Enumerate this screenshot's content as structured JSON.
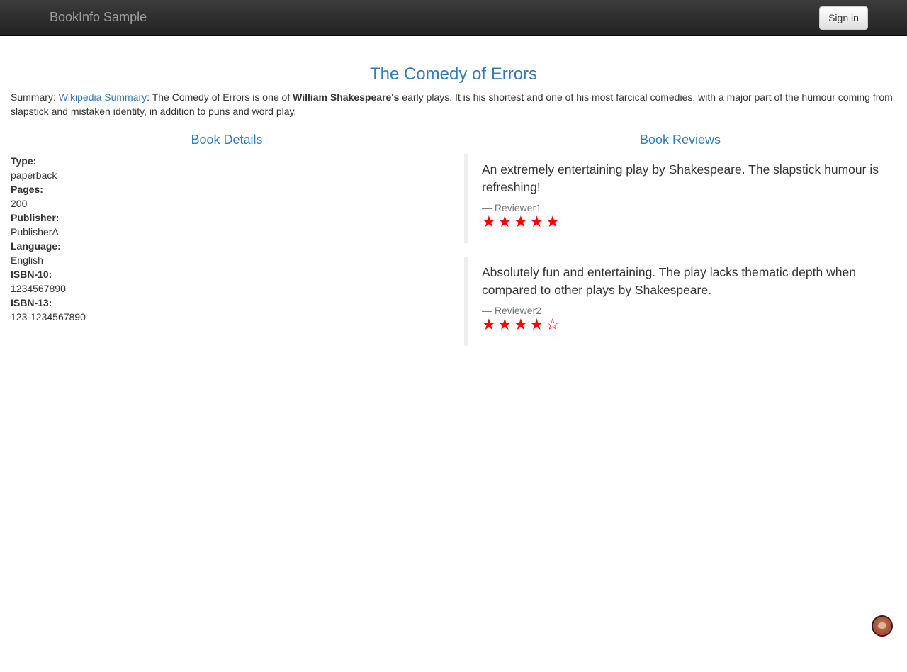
{
  "navbar": {
    "brand": "BookInfo Sample",
    "signin_label": "Sign in"
  },
  "book": {
    "title": "The Comedy of Errors",
    "summary_prefix": "Summary: ",
    "summary_link": "Wikipedia Summary",
    "summary_text_1": ": The Comedy of Errors is one of ",
    "summary_bold": "William Shakespeare's",
    "summary_text_2": " early plays. It is his shortest and one of his most farcical comedies, with a major part of the humour coming from slapstick and mistaken identity, in addition to puns and word play."
  },
  "details": {
    "heading": "Book Details",
    "items": [
      {
        "label": "Type:",
        "value": "paperback"
      },
      {
        "label": "Pages:",
        "value": "200"
      },
      {
        "label": "Publisher:",
        "value": "PublisherA"
      },
      {
        "label": "Language:",
        "value": "English"
      },
      {
        "label": "ISBN-10:",
        "value": "1234567890"
      },
      {
        "label": "ISBN-13:",
        "value": "123-1234567890"
      }
    ]
  },
  "reviews": {
    "heading": "Book Reviews",
    "items": [
      {
        "text": "An extremely entertaining play by Shakespeare. The slapstick humour is refreshing!",
        "author": "— Reviewer1",
        "rating": 5,
        "max_rating": 5,
        "star_color": "#ff0000"
      },
      {
        "text": "Absolutely fun and entertaining. The play lacks thematic depth when compared to other plays by Shakespeare.",
        "author": "— Reviewer2",
        "rating": 4,
        "max_rating": 5,
        "star_color": "#ff0000"
      }
    ]
  },
  "icons": {
    "filled_star": "star-filled-icon",
    "empty_star": "star-empty-icon",
    "avatar": "avatar-icon"
  },
  "colors": {
    "accent": "#337ab7",
    "navbar_bg": "#222222",
    "star": "#ff0000"
  }
}
